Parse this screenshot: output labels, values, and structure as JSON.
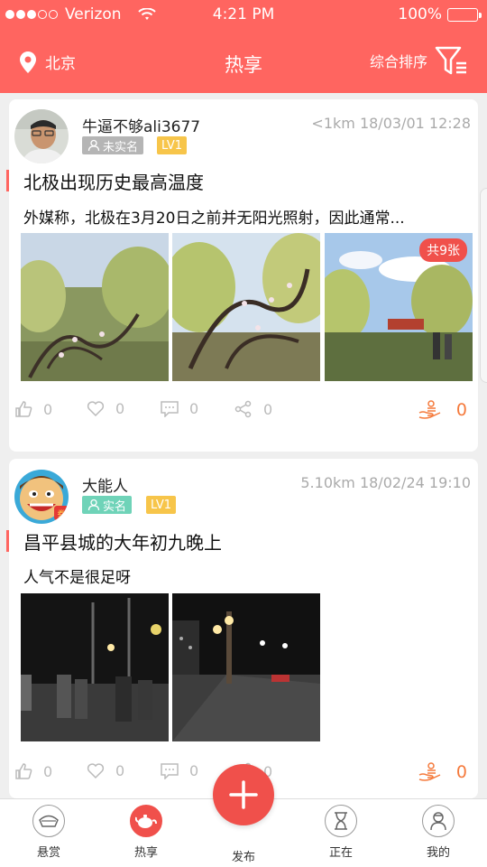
{
  "status_bar": {
    "carrier": "Verizon",
    "time": "4:21 PM",
    "battery": "100%"
  },
  "nav": {
    "location": "北京",
    "title": "热享",
    "sort_label": "综合排序"
  },
  "posts": [
    {
      "username": "牛逼不够ali3677",
      "distance_time": "<1km  18/03/01 12:28",
      "verify_label": "未实名",
      "level": "LV1",
      "title": "北极出现历史最高温度",
      "desc": "外媒称，北极在3月20日之前并无阳光照射，因此通常...",
      "photo_count_tag": "共9张",
      "likes": "0",
      "favorites": "0",
      "comments": "0",
      "shares": "0",
      "reward": "0"
    },
    {
      "username": "大能人",
      "distance_time": "5.10km  18/02/24 19:10",
      "verify_label": "实名",
      "level": "LV1",
      "title": "昌平县城的大年初九晚上",
      "desc": "人气不是很足呀",
      "likes": "0",
      "favorites": "0",
      "comments": "0",
      "shares": "0",
      "reward": "0"
    }
  ],
  "tabs": [
    {
      "label": "悬赏",
      "icon": "treasure-icon"
    },
    {
      "label": "热享",
      "icon": "teapot-icon"
    },
    {
      "label": "发布",
      "icon": "plus-icon"
    },
    {
      "label": "正在",
      "icon": "hourglass-icon"
    },
    {
      "label": "我的",
      "icon": "person-icon"
    }
  ],
  "colors": {
    "brand": "#ff6560",
    "accent": "#f0504b",
    "level": "#f7c54a",
    "unverified": "#b5b5b5",
    "verified": "#6fd3b8",
    "reward": "#f57a3c"
  }
}
